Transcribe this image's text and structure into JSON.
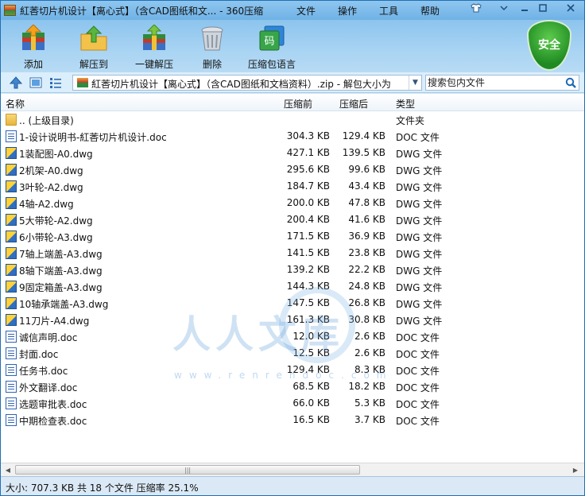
{
  "window": {
    "title": "紅莕切片机设计【离心式】（含CAD图纸和文... - 360压缩",
    "menus": [
      "文件",
      "操作",
      "工具",
      "帮助"
    ]
  },
  "toolbar": {
    "buttons": [
      {
        "label": "添加",
        "icon": "add-archive-icon"
      },
      {
        "label": "解压到",
        "icon": "extract-to-icon"
      },
      {
        "label": "一键解压",
        "icon": "one-click-extract-icon"
      },
      {
        "label": "删除",
        "icon": "trash-icon"
      },
      {
        "label": "压缩包语言",
        "icon": "archive-language-icon"
      }
    ],
    "security_badge": "安全"
  },
  "address": {
    "path": "紅莕切片机设计【离心式】（含CAD图纸和文档资料）.zip - 解包大小为"
  },
  "search": {
    "placeholder": "搜索包内文件"
  },
  "columns": {
    "name": "名称",
    "original": "压缩前",
    "compressed": "压缩后",
    "type": "类型"
  },
  "files": [
    {
      "name": ".. (上级目录)",
      "orig": "",
      "comp": "",
      "type": "文件夹",
      "kind": "folder"
    },
    {
      "name": "1-设计说明书-紅莕切片机设计.doc",
      "orig": "304.3 KB",
      "comp": "129.4 KB",
      "type": "DOC 文件",
      "kind": "doc"
    },
    {
      "name": "1装配图-A0.dwg",
      "orig": "427.1 KB",
      "comp": "139.5 KB",
      "type": "DWG 文件",
      "kind": "dwg"
    },
    {
      "name": "2机架-A0.dwg",
      "orig": "295.6 KB",
      "comp": "99.6 KB",
      "type": "DWG 文件",
      "kind": "dwg"
    },
    {
      "name": "3叶轮-A2.dwg",
      "orig": "184.7 KB",
      "comp": "43.4 KB",
      "type": "DWG 文件",
      "kind": "dwg"
    },
    {
      "name": "4轴-A2.dwg",
      "orig": "200.0 KB",
      "comp": "47.8 KB",
      "type": "DWG 文件",
      "kind": "dwg"
    },
    {
      "name": "5大带轮-A2.dwg",
      "orig": "200.4 KB",
      "comp": "41.6 KB",
      "type": "DWG 文件",
      "kind": "dwg"
    },
    {
      "name": "6小带轮-A3.dwg",
      "orig": "171.5 KB",
      "comp": "36.9 KB",
      "type": "DWG 文件",
      "kind": "dwg"
    },
    {
      "name": "7轴上端盖-A3.dwg",
      "orig": "141.5 KB",
      "comp": "23.8 KB",
      "type": "DWG 文件",
      "kind": "dwg"
    },
    {
      "name": "8轴下端盖-A3.dwg",
      "orig": "139.2 KB",
      "comp": "22.2 KB",
      "type": "DWG 文件",
      "kind": "dwg"
    },
    {
      "name": "9固定箱盖-A3.dwg",
      "orig": "144.3 KB",
      "comp": "24.8 KB",
      "type": "DWG 文件",
      "kind": "dwg"
    },
    {
      "name": "10轴承端盖-A3.dwg",
      "orig": "147.5 KB",
      "comp": "26.8 KB",
      "type": "DWG 文件",
      "kind": "dwg"
    },
    {
      "name": "11刀片-A4.dwg",
      "orig": "161.3 KB",
      "comp": "30.8 KB",
      "type": "DWG 文件",
      "kind": "dwg"
    },
    {
      "name": "诚信声明.doc",
      "orig": "12.0 KB",
      "comp": "2.6 KB",
      "type": "DOC 文件",
      "kind": "doc"
    },
    {
      "name": "封面.doc",
      "orig": "12.5 KB",
      "comp": "2.6 KB",
      "type": "DOC 文件",
      "kind": "doc"
    },
    {
      "name": "任务书.doc",
      "orig": "129.4 KB",
      "comp": "8.3 KB",
      "type": "DOC 文件",
      "kind": "doc"
    },
    {
      "name": "外文翻译.doc",
      "orig": "68.5 KB",
      "comp": "18.2 KB",
      "type": "DOC 文件",
      "kind": "doc"
    },
    {
      "name": "选题审批表.doc",
      "orig": "66.0 KB",
      "comp": "5.3 KB",
      "type": "DOC 文件",
      "kind": "doc"
    },
    {
      "name": "中期检查表.doc",
      "orig": "16.5 KB",
      "comp": "3.7 KB",
      "type": "DOC 文件",
      "kind": "doc"
    }
  ],
  "watermark": {
    "text": "人人文库",
    "url": "www.renrendoc.com"
  },
  "status": {
    "text": "大小: 707.3 KB 共 18 个文件 压缩率 25.1%"
  }
}
